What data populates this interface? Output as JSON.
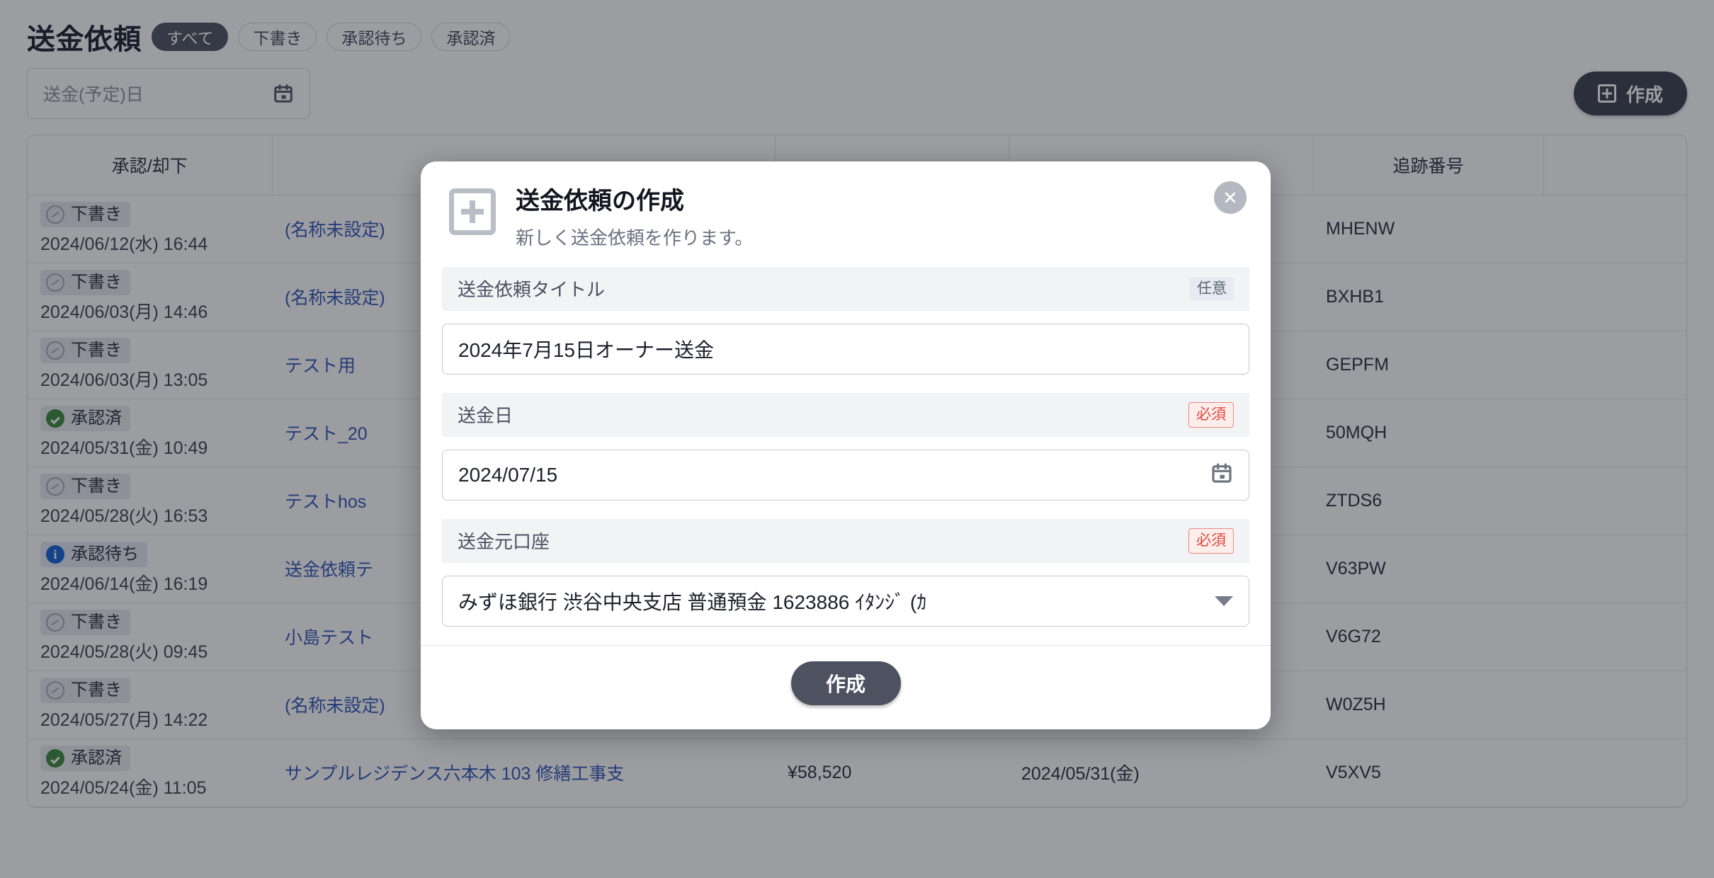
{
  "header": {
    "title": "送金依頼",
    "filters": [
      {
        "label": "すべて",
        "active": true
      },
      {
        "label": "下書き",
        "active": false
      },
      {
        "label": "承認待ち",
        "active": false
      },
      {
        "label": "承認済",
        "active": false
      }
    ],
    "date_filter_placeholder": "送金(予定)日",
    "date_filter_value": "",
    "create_button": "作成",
    "calendar_icon": "calendar-icon",
    "plus_icon": "plus-square-icon"
  },
  "table": {
    "columns": [
      {
        "key": "status",
        "label": "承認/却下"
      },
      {
        "key": "title",
        "label": ""
      },
      {
        "key": "amount",
        "label": ""
      },
      {
        "key": "date",
        "label": ""
      },
      {
        "key": "track",
        "label": "追跡番号"
      },
      {
        "key": "last",
        "label": ""
      }
    ],
    "rows": [
      {
        "status": "下書き",
        "status_kind": "draft",
        "status_icon": "clock-circle-icon",
        "timestamp": "2024/06/12(水) 16:44",
        "title": "(名称未設定)",
        "amount": "",
        "date": "",
        "track": "MHENW"
      },
      {
        "status": "下書き",
        "status_kind": "draft",
        "status_icon": "clock-circle-icon",
        "timestamp": "2024/06/03(月) 14:46",
        "title": "(名称未設定)",
        "amount": "",
        "date": "",
        "track": "BXHB1"
      },
      {
        "status": "下書き",
        "status_kind": "draft",
        "status_icon": "clock-circle-icon",
        "timestamp": "2024/06/03(月) 13:05",
        "title": "テスト用",
        "amount": "",
        "date": "",
        "track": "GEPFM"
      },
      {
        "status": "承認済",
        "status_kind": "approved",
        "status_icon": "check-circle-icon",
        "timestamp": "2024/05/31(金) 10:49",
        "title": "テスト_20",
        "amount": "",
        "date": "",
        "track": "50MQH"
      },
      {
        "status": "下書き",
        "status_kind": "draft",
        "status_icon": "clock-circle-icon",
        "timestamp": "2024/05/28(火) 16:53",
        "title": "テストhos",
        "amount": "",
        "date": "",
        "track": "ZTDS6"
      },
      {
        "status": "承認待ち",
        "status_kind": "pending",
        "status_icon": "info-circle-icon",
        "timestamp": "2024/06/14(金) 16:19",
        "title": "送金依頼テ",
        "amount": "",
        "date": "",
        "track": "V63PW"
      },
      {
        "status": "下書き",
        "status_kind": "draft",
        "status_icon": "clock-circle-icon",
        "timestamp": "2024/05/28(火) 09:45",
        "title": "小島テスト",
        "amount": "",
        "date": "",
        "track": "V6G72"
      },
      {
        "status": "下書き",
        "status_kind": "draft",
        "status_icon": "clock-circle-icon",
        "timestamp": "2024/05/27(月) 14:22",
        "title": "(名称未設定)",
        "amount": "",
        "date": "",
        "track": "W0Z5H"
      },
      {
        "status": "承認済",
        "status_kind": "approved",
        "status_icon": "check-circle-icon",
        "timestamp": "2024/05/24(金) 11:05",
        "title": "サンプルレジデンス六本木 103 修繕工事支",
        "amount": "¥58,520",
        "date": "2024/05/31(金)",
        "track": "V5XV5"
      }
    ]
  },
  "modal": {
    "title": "送金依頼の作成",
    "subtitle": "新しく送金依頼を作ります。",
    "icon": "plus-square-icon",
    "close_icon": "close-icon",
    "fields": [
      {
        "label": "送金依頼タイトル",
        "tag": "任意",
        "tag_kind": "optional",
        "value": "2024年7月15日オーナー送金",
        "control": "text",
        "trailing_icon": ""
      },
      {
        "label": "送金日",
        "tag": "必須",
        "tag_kind": "required",
        "value": "2024/07/15",
        "control": "date",
        "trailing_icon": "calendar-icon"
      },
      {
        "label": "送金元口座",
        "tag": "必須",
        "tag_kind": "required",
        "value": "みずほ銀行 渋谷中央支店 普通預金 1623886 ｲﾀﾝｼﾞ (ｶ",
        "control": "select",
        "trailing_icon": "chevron-down-icon"
      }
    ],
    "submit_label": "作成"
  },
  "colors": {
    "accent": "#3558b8",
    "required": "#e0463a",
    "approved": "#3f8a3f",
    "pending": "#1565d8",
    "button_dark": "#4e5260",
    "overlay": "rgba(20,22,30,0.42)"
  }
}
